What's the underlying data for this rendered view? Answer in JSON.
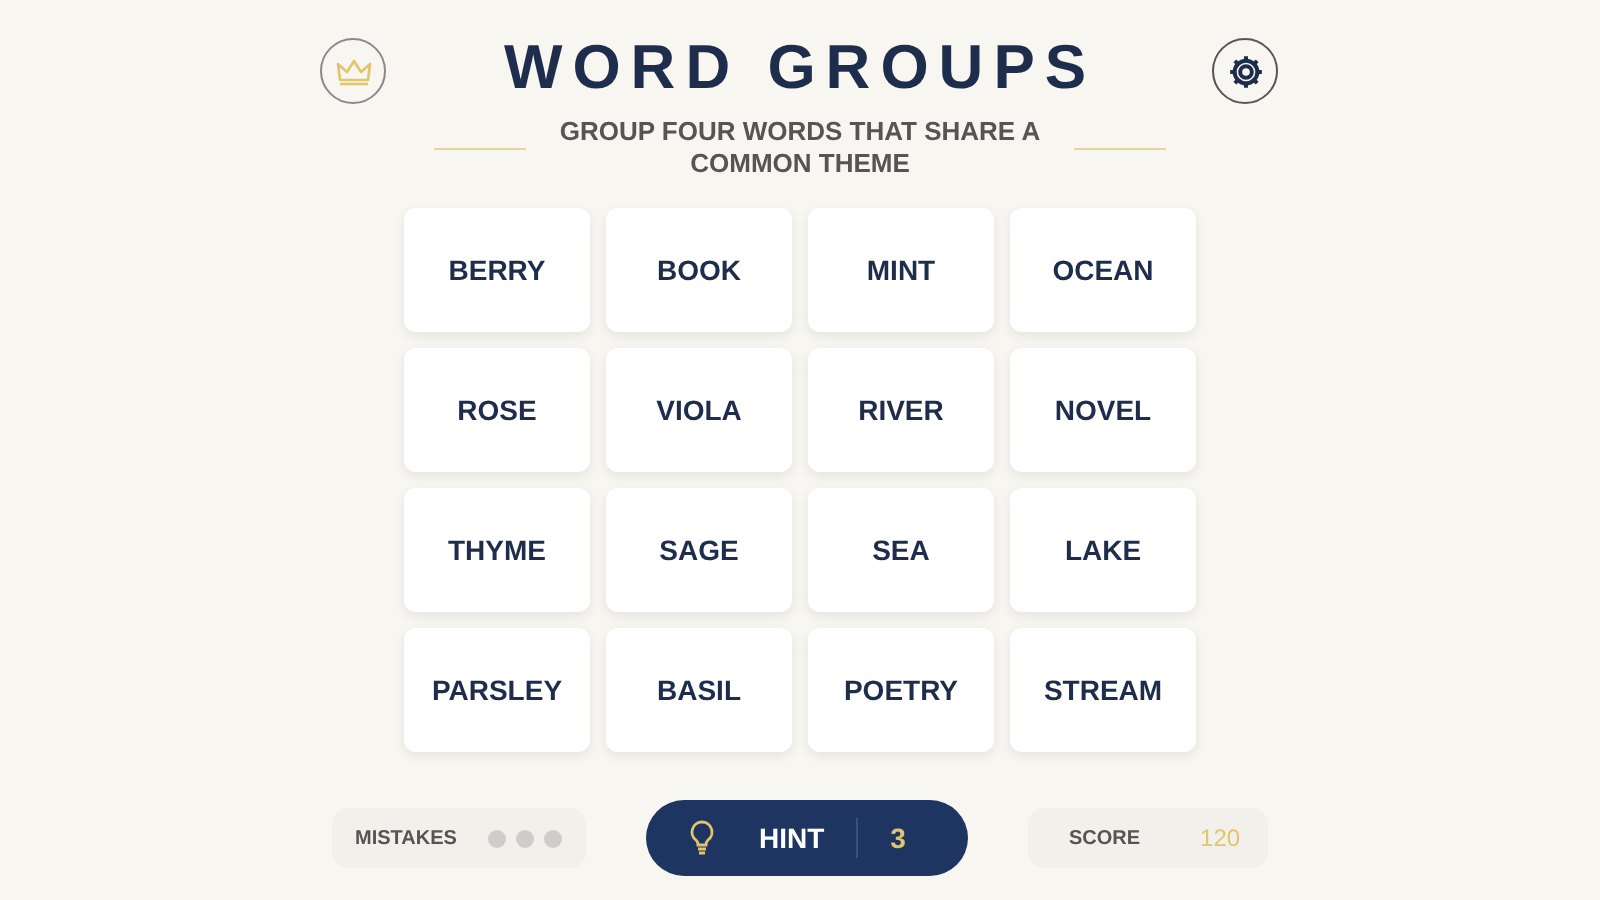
{
  "title": "WORD GROUPS",
  "subtitle": "GROUP FOUR WORDS THAT SHARE A COMMON THEME",
  "tiles": [
    {
      "word": "BERRY"
    },
    {
      "word": "BOOK"
    },
    {
      "word": "MINT"
    },
    {
      "word": "OCEAN"
    },
    {
      "word": "ROSE"
    },
    {
      "word": "VIOLA"
    },
    {
      "word": "RIVER"
    },
    {
      "word": "NOVEL"
    },
    {
      "word": "THYME"
    },
    {
      "word": "SAGE"
    },
    {
      "word": "SEA"
    },
    {
      "word": "LAKE"
    },
    {
      "word": "PARSLEY"
    },
    {
      "word": "BASIL"
    },
    {
      "word": "POETRY"
    },
    {
      "word": "STREAM"
    }
  ],
  "mistakes": {
    "label": "MISTAKES",
    "dots": [
      {
        "used": false
      },
      {
        "used": false
      },
      {
        "used": false
      }
    ]
  },
  "hint": {
    "label": "HINT",
    "count": "3"
  },
  "score": {
    "label": "SCORE",
    "value": "120"
  }
}
